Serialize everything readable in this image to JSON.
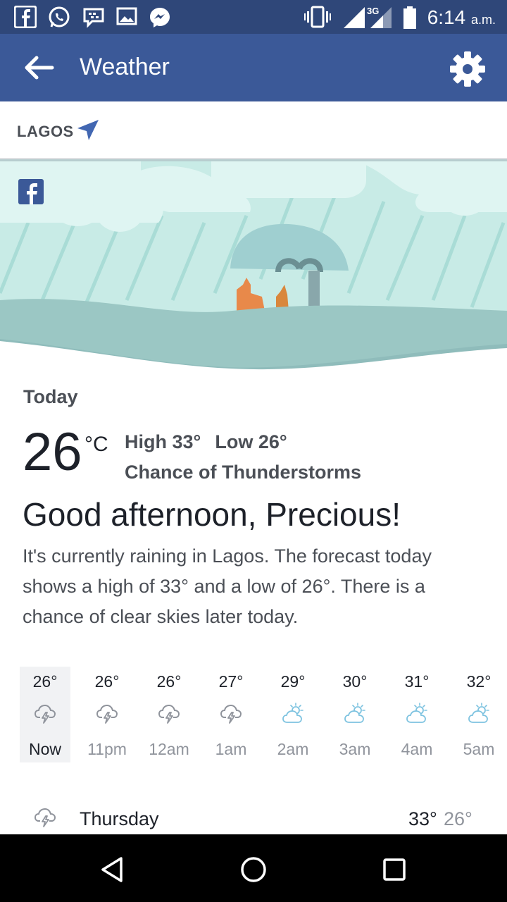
{
  "status_bar": {
    "time": "6:14",
    "ampm": "a.m.",
    "network": "3G",
    "icons": [
      "facebook-icon",
      "whatsapp-icon",
      "bbm-icon",
      "gallery-icon",
      "messenger-icon",
      "vibrate-icon",
      "signal-icon",
      "battery-icon"
    ]
  },
  "app_bar": {
    "title": "Weather"
  },
  "location": {
    "name": "LAGOS"
  },
  "today": {
    "label": "Today",
    "temp": "26",
    "unit": "°C",
    "high": "High 33°",
    "low": "Low 26°",
    "condition": "Chance of Thunderstorms",
    "greeting": "Good afternoon, Precious!",
    "summary": "It's currently raining in Lagos. The forecast today shows a high of 33° and a low of 26°. There is a chance of clear skies later today."
  },
  "hourly": [
    {
      "temp": "26°",
      "label": "Now",
      "icon": "thunderstorm-icon"
    },
    {
      "temp": "26°",
      "label": "11pm",
      "icon": "thunderstorm-icon"
    },
    {
      "temp": "26°",
      "label": "12am",
      "icon": "thunderstorm-icon"
    },
    {
      "temp": "27°",
      "label": "1am",
      "icon": "thunderstorm-icon"
    },
    {
      "temp": "29°",
      "label": "2am",
      "icon": "partly-cloudy-icon"
    },
    {
      "temp": "30°",
      "label": "3am",
      "icon": "partly-cloudy-icon"
    },
    {
      "temp": "31°",
      "label": "4am",
      "icon": "partly-cloudy-icon"
    },
    {
      "temp": "32°",
      "label": "5am",
      "icon": "partly-cloudy-icon"
    }
  ],
  "daily": [
    {
      "day": "Thursday",
      "high": "33°",
      "low": "26°",
      "icon": "thunderstorm-icon"
    }
  ],
  "colors": {
    "status_bar": "#2f4779",
    "app_bar": "#3b5998",
    "accent": "#4267b2",
    "hero_bg": "#c8ebe6"
  }
}
